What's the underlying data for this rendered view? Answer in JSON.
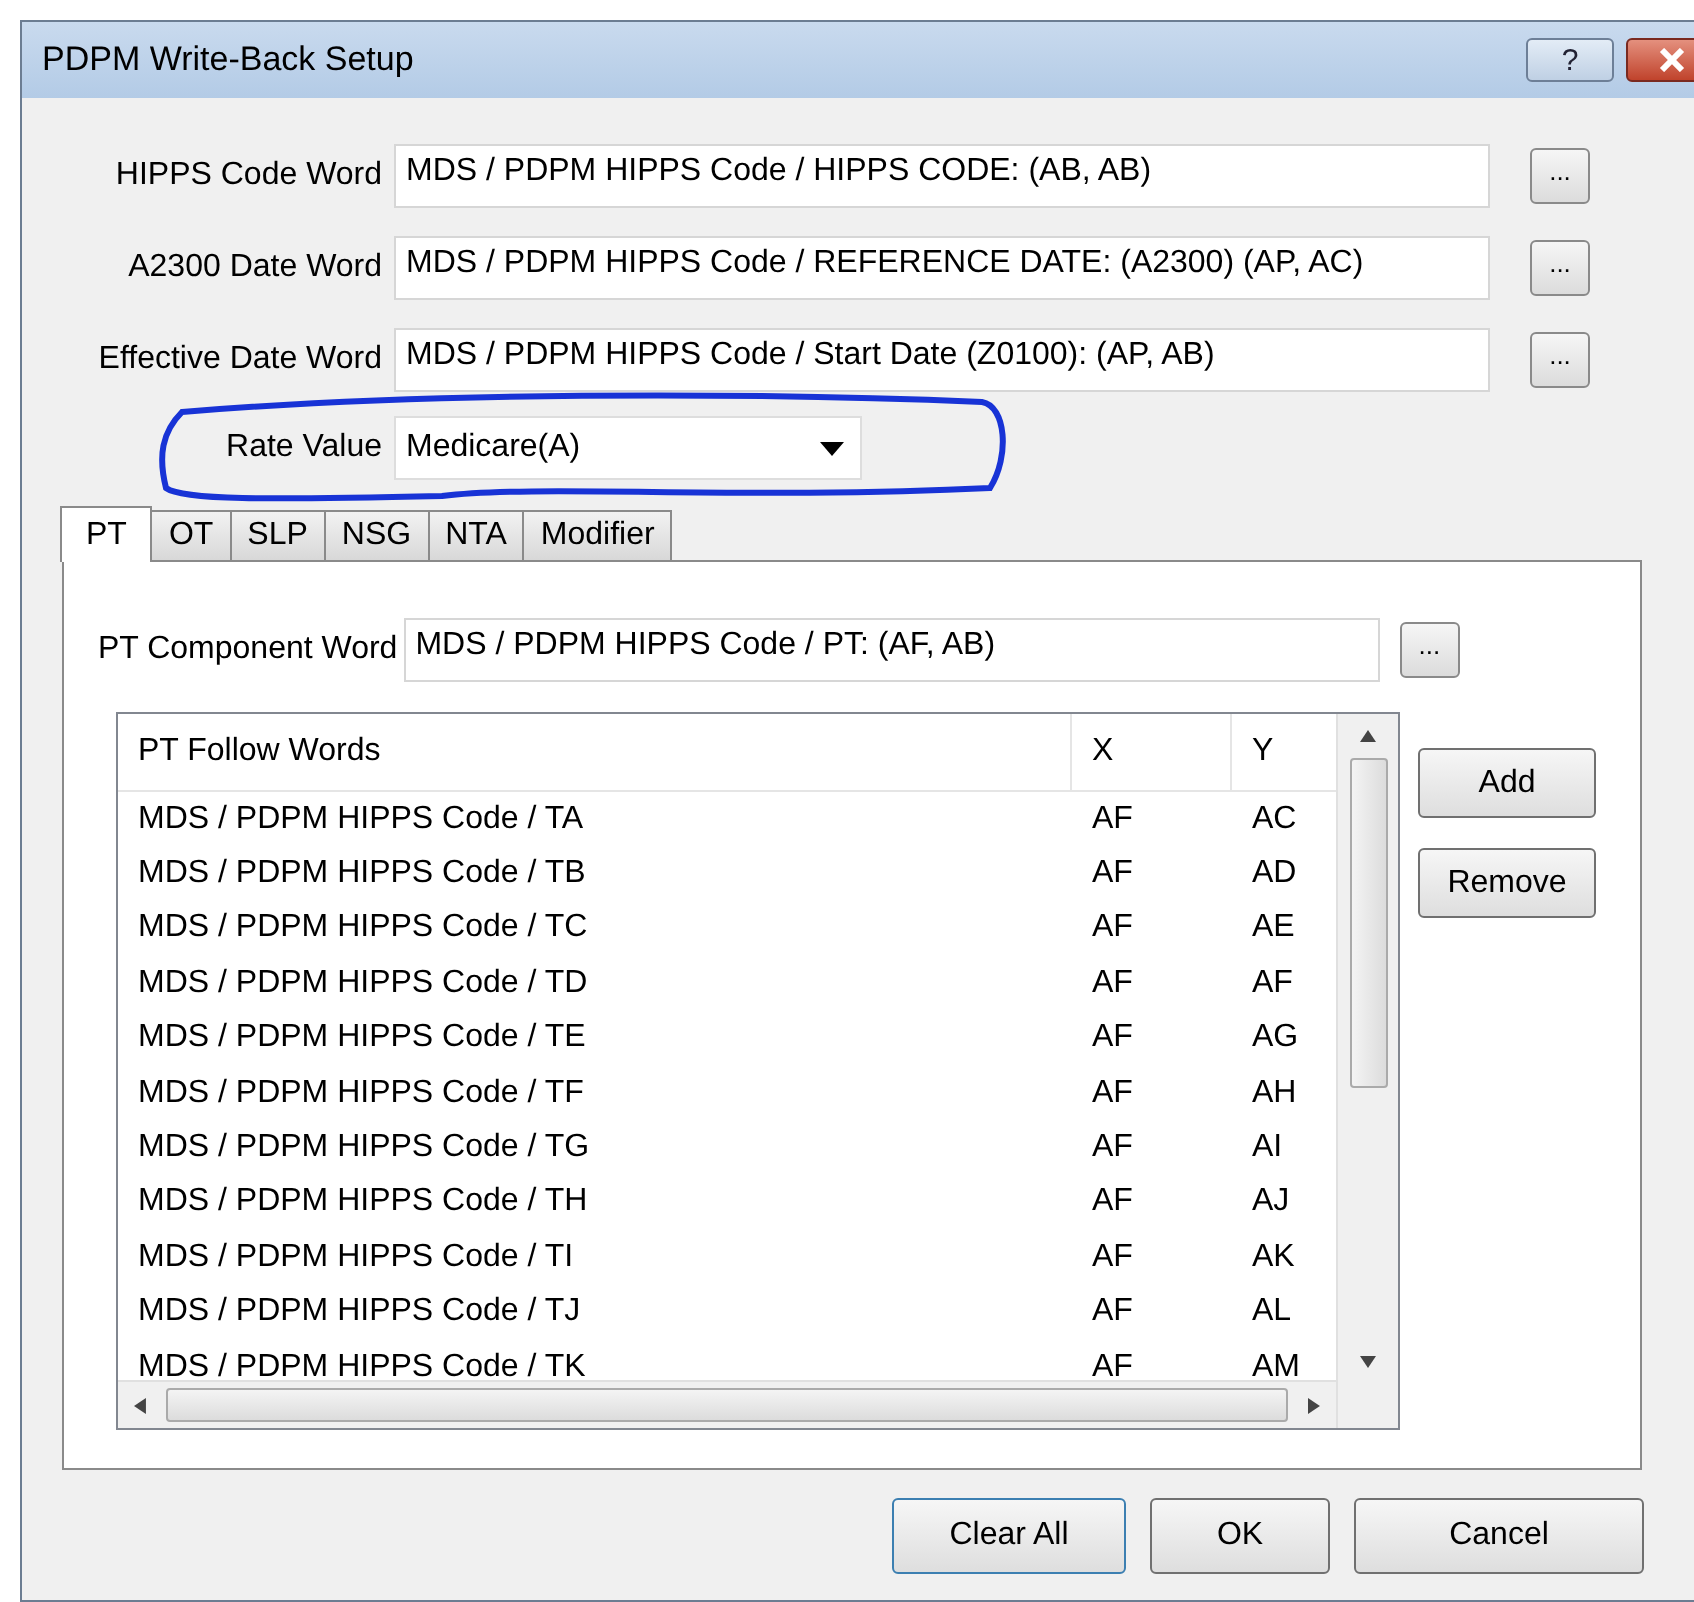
{
  "window": {
    "title": "PDPM Write-Back Setup",
    "help_button": "?"
  },
  "word_fields": [
    {
      "label": "HIPPS Code Word",
      "value": "MDS / PDPM HIPPS Code / HIPPS CODE: (AB, AB)",
      "browse": "..."
    },
    {
      "label": "A2300 Date Word",
      "value": "MDS / PDPM HIPPS Code / REFERENCE DATE: (A2300) (AP, AC)",
      "browse": "..."
    },
    {
      "label": "Effective Date Word",
      "value": "MDS / PDPM HIPPS Code / Start Date (Z0100): (AP, AB)",
      "browse": "..."
    }
  ],
  "rate_value": {
    "label": "Rate Value",
    "value": "Medicare(A)"
  },
  "tabs": [
    {
      "label": "PT",
      "selected": true
    },
    {
      "label": "OT",
      "selected": false
    },
    {
      "label": "SLP",
      "selected": false
    },
    {
      "label": "NSG",
      "selected": false
    },
    {
      "label": "NTA",
      "selected": false
    },
    {
      "label": "Modifier",
      "selected": false
    }
  ],
  "component_word": {
    "label": "PT Component Word",
    "value": "MDS / PDPM HIPPS Code / PT: (AF, AB)",
    "browse": "..."
  },
  "follow_words": {
    "columns": [
      "PT Follow Words",
      "X",
      "Y"
    ],
    "rows": [
      [
        "MDS / PDPM HIPPS Code / TA",
        "AF",
        "AC"
      ],
      [
        "MDS / PDPM HIPPS Code / TB",
        "AF",
        "AD"
      ],
      [
        "MDS / PDPM HIPPS Code / TC",
        "AF",
        "AE"
      ],
      [
        "MDS / PDPM HIPPS Code / TD",
        "AF",
        "AF"
      ],
      [
        "MDS / PDPM HIPPS Code / TE",
        "AF",
        "AG"
      ],
      [
        "MDS / PDPM HIPPS Code / TF",
        "AF",
        "AH"
      ],
      [
        "MDS / PDPM HIPPS Code / TG",
        "AF",
        "AI"
      ],
      [
        "MDS / PDPM HIPPS Code / TH",
        "AF",
        "AJ"
      ],
      [
        "MDS / PDPM HIPPS Code / TI",
        "AF",
        "AK"
      ],
      [
        "MDS / PDPM HIPPS Code / TJ",
        "AF",
        "AL"
      ],
      [
        "MDS / PDPM HIPPS Code / TK",
        "AF",
        "AM"
      ]
    ]
  },
  "list_buttons": [
    "Add",
    "Remove"
  ],
  "footer_buttons": [
    "Clear All",
    "OK",
    "Cancel"
  ]
}
